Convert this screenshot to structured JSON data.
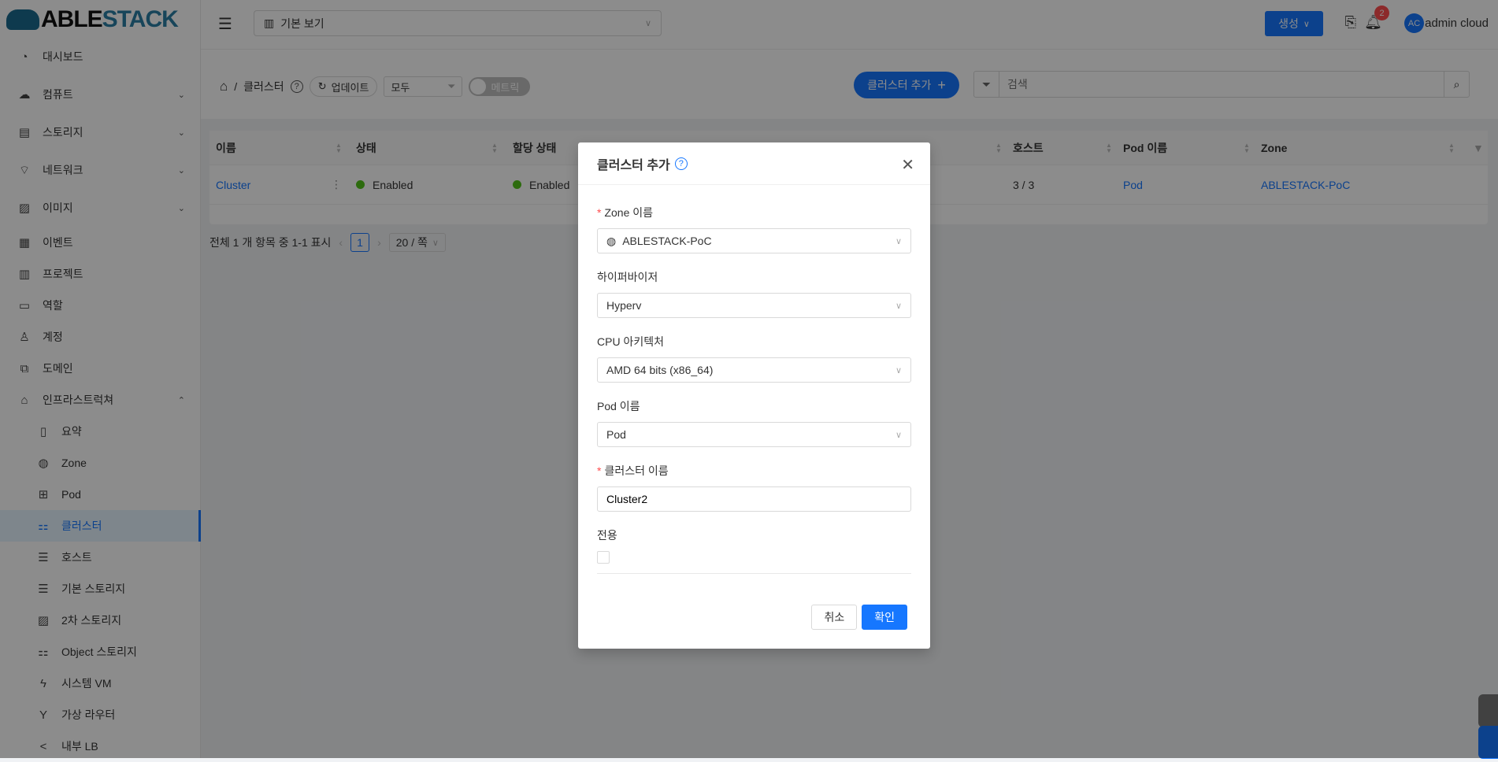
{
  "logo": {
    "part1": "ABLE",
    "part2": "STACK"
  },
  "sidebar": {
    "items": [
      {
        "label": "대시보드",
        "icon": "dashboard-icon",
        "glyph": "◔"
      },
      {
        "label": "컴퓨트",
        "icon": "cloud-icon",
        "glyph": "☁",
        "chev": "⌄"
      },
      {
        "label": "스토리지",
        "icon": "storage-icon",
        "glyph": "▤",
        "chev": "⌄"
      },
      {
        "label": "네트워크",
        "icon": "wifi-icon",
        "glyph": "⌔",
        "chev": "⌄"
      },
      {
        "label": "이미지",
        "icon": "image-icon",
        "glyph": "▨",
        "chev": "⌄"
      },
      {
        "label": "이벤트",
        "icon": "calendar-icon",
        "glyph": "▦"
      },
      {
        "label": "프로젝트",
        "icon": "project-icon",
        "glyph": "▥"
      },
      {
        "label": "역할",
        "icon": "idcard-icon",
        "glyph": "▭"
      },
      {
        "label": "계정",
        "icon": "user-icon",
        "glyph": "♙"
      },
      {
        "label": "도메인",
        "icon": "block-icon",
        "glyph": "⧉"
      },
      {
        "label": "인프라스트럭쳐",
        "icon": "bank-icon",
        "glyph": "⌂",
        "chev": "⌃"
      }
    ],
    "sub_items": [
      {
        "label": "요약",
        "icon": "read-icon",
        "glyph": "▯"
      },
      {
        "label": "Zone",
        "icon": "globe-icon",
        "glyph": "◍"
      },
      {
        "label": "Pod",
        "icon": "appstore-icon",
        "glyph": "⊞"
      },
      {
        "label": "클러스터",
        "icon": "cluster-icon",
        "glyph": "⚏"
      },
      {
        "label": "호스트",
        "icon": "host-icon",
        "glyph": "☰"
      },
      {
        "label": "기본 스토리지",
        "icon": "database-icon",
        "glyph": "☰"
      },
      {
        "label": "2차 스토리지",
        "icon": "picture-icon",
        "glyph": "▨"
      },
      {
        "label": "Object 스토리지",
        "icon": "object-storage-icon",
        "glyph": "⚏"
      },
      {
        "label": "시스템 VM",
        "icon": "thunderbolt-icon",
        "glyph": "ϟ"
      },
      {
        "label": "가상 라우터",
        "icon": "fork-icon",
        "glyph": "Y"
      },
      {
        "label": "내부 LB",
        "icon": "share-icon",
        "glyph": "<"
      }
    ]
  },
  "header": {
    "view_label": "기본 보기",
    "create_label": "생성",
    "notification_count": "2",
    "avatar_initials": "AC",
    "username": "admin cloud"
  },
  "toolbar": {
    "crumb_title": "클러스터",
    "refresh_label": "업데이트",
    "filter_value": "모두",
    "metrics_label": "메트릭",
    "add_label": "클러스터 추가",
    "search_placeholder": "검색"
  },
  "table": {
    "columns": [
      "이름",
      "상태",
      "할당 상태",
      "호스트",
      "Pod 이름",
      "Zone"
    ],
    "rows": [
      {
        "name": "Cluster",
        "state": "Enabled",
        "alloc": "Enabled",
        "hosts": "3 / 3",
        "pod": "Pod",
        "zone": "ABLESTACK-PoC"
      }
    ]
  },
  "pagination": {
    "summary": "전체 1 개 항목 중 1-1 표시",
    "current": "1",
    "page_size": "20 / 쪽"
  },
  "modal": {
    "title": "클러스터 추가",
    "zone_label": "Zone 이름",
    "zone_value": "ABLESTACK-PoC",
    "hypervisor_label": "하이퍼바이저",
    "hypervisor_value": "Hyperv",
    "arch_label": "CPU 아키텍처",
    "arch_value": "AMD 64 bits (x86_64)",
    "pod_label": "Pod 이름",
    "pod_value": "Pod",
    "name_label": "클러스터 이름",
    "name_value": "Cluster2",
    "dedicated_label": "전용",
    "cancel_label": "취소",
    "ok_label": "확인"
  },
  "colors": {
    "primary": "#1677ff",
    "enabled": "#52c41a",
    "badge": "#ff4d4f"
  }
}
